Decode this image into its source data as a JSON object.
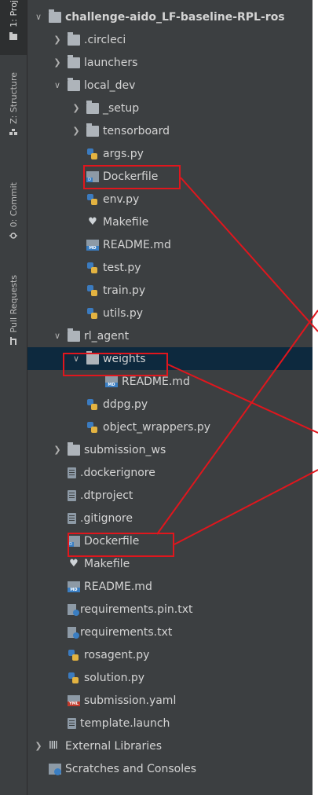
{
  "sidebar": {
    "tabs": [
      {
        "label": "1: Proj",
        "icon": "folder-icon"
      },
      {
        "label": "Z: Structure",
        "icon": "structure-icon"
      },
      {
        "label": "0: Commit",
        "icon": "commit-icon"
      },
      {
        "label": "Pull Requests",
        "icon": "pull-request-icon"
      }
    ]
  },
  "tree": [
    {
      "label": "challenge-aido_LF-baseline-RPL-ros",
      "indent": 0,
      "icon": "folder",
      "chevron": "open",
      "bold": true
    },
    {
      "label": ".circleci",
      "indent": 1,
      "icon": "folder",
      "chevron": "closed"
    },
    {
      "label": "launchers",
      "indent": 1,
      "icon": "folder",
      "chevron": "closed"
    },
    {
      "label": "local_dev",
      "indent": 1,
      "icon": "folder",
      "chevron": "open"
    },
    {
      "label": "_setup",
      "indent": 2,
      "icon": "folder",
      "chevron": "closed"
    },
    {
      "label": "tensorboard",
      "indent": 2,
      "icon": "folder",
      "chevron": "closed"
    },
    {
      "label": "args.py",
      "indent": 2,
      "icon": "python"
    },
    {
      "label": "Dockerfile",
      "indent": 2,
      "icon": "docker"
    },
    {
      "label": "env.py",
      "indent": 2,
      "icon": "python"
    },
    {
      "label": "Makefile",
      "indent": 2,
      "icon": "makefile"
    },
    {
      "label": "README.md",
      "indent": 2,
      "icon": "markdown"
    },
    {
      "label": "test.py",
      "indent": 2,
      "icon": "python"
    },
    {
      "label": "train.py",
      "indent": 2,
      "icon": "python"
    },
    {
      "label": "utils.py",
      "indent": 2,
      "icon": "python"
    },
    {
      "label": "rl_agent",
      "indent": 1,
      "icon": "folder",
      "chevron": "open"
    },
    {
      "label": "weights",
      "indent": 2,
      "icon": "folder",
      "chevron": "open",
      "selected": true
    },
    {
      "label": "README.md",
      "indent": 3,
      "icon": "markdown"
    },
    {
      "label": "ddpg.py",
      "indent": 2,
      "icon": "python"
    },
    {
      "label": "object_wrappers.py",
      "indent": 2,
      "icon": "python"
    },
    {
      "label": "submission_ws",
      "indent": 1,
      "icon": "folder",
      "chevron": "closed"
    },
    {
      "label": ".dockerignore",
      "indent": 1,
      "icon": "text"
    },
    {
      "label": ".dtproject",
      "indent": 1,
      "icon": "text"
    },
    {
      "label": ".gitignore",
      "indent": 1,
      "icon": "text"
    },
    {
      "label": "Dockerfile",
      "indent": 1,
      "icon": "docker"
    },
    {
      "label": "Makefile",
      "indent": 1,
      "icon": "makefile"
    },
    {
      "label": "README.md",
      "indent": 1,
      "icon": "markdown"
    },
    {
      "label": "requirements.pin.txt",
      "indent": 1,
      "icon": "requirements"
    },
    {
      "label": "requirements.txt",
      "indent": 1,
      "icon": "requirements"
    },
    {
      "label": "rosagent.py",
      "indent": 1,
      "icon": "python"
    },
    {
      "label": "solution.py",
      "indent": 1,
      "icon": "python"
    },
    {
      "label": "submission.yaml",
      "indent": 1,
      "icon": "yaml"
    },
    {
      "label": "template.launch",
      "indent": 1,
      "icon": "text"
    },
    {
      "label": "External Libraries",
      "indent": 0,
      "icon": "libraries",
      "chevron": "closed"
    },
    {
      "label": "Scratches and Consoles",
      "indent": 0,
      "icon": "scratch"
    }
  ],
  "icon_badges": {
    "docker": "D",
    "markdown": "MD",
    "yaml": "YML"
  },
  "colors": {
    "highlight": "#e0161d",
    "selection": "#0d293e",
    "panel": "#3c3f41"
  }
}
